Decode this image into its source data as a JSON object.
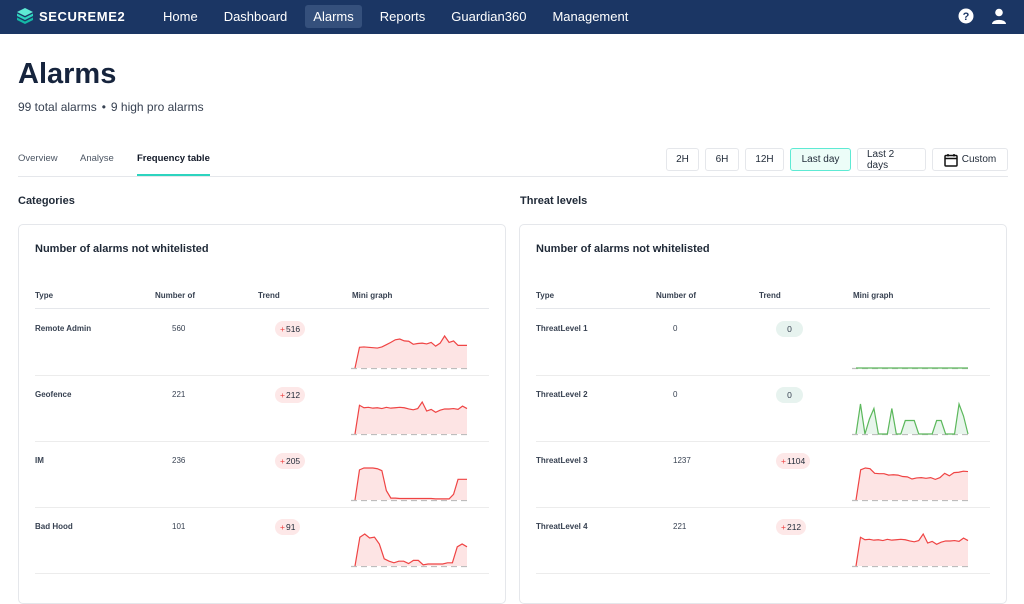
{
  "app": {
    "brand": "SECUREME2",
    "nav": [
      "Home",
      "Dashboard",
      "Alarms",
      "Reports",
      "Guardian360",
      "Management"
    ],
    "active_nav": "Alarms",
    "icons": [
      "help-icon",
      "user-icon"
    ]
  },
  "page": {
    "title": "Alarms",
    "total": "99 total alarms",
    "separator": "•",
    "high": "9 high pro alarms"
  },
  "tabs": [
    "Overview",
    "Analyse",
    "Frequency table"
  ],
  "active_tab": "Frequency table",
  "ranges": [
    "2H",
    "6H",
    "12H",
    "Last day",
    "Last 2 days",
    "Custom"
  ],
  "active_range": "Last day",
  "colors": {
    "nav_bg": "#1b3664",
    "accent": "#2dd4bf",
    "trend_up": "#ef4444",
    "trend_zero": "#5cb85c"
  },
  "sections": [
    {
      "title": "Categories",
      "card_title": "Number of alarms not whitelisted",
      "columns": [
        "Type",
        "Number of",
        "Trend",
        "Mini graph"
      ],
      "rows": [
        {
          "type": "Remote Admin",
          "count": "560",
          "trend": "516",
          "dir": "up",
          "series": [
            0,
            55,
            56,
            55,
            54,
            53,
            56,
            62,
            68,
            75,
            77,
            72,
            71,
            63,
            65,
            66,
            64,
            68,
            58,
            66,
            85,
            68,
            72,
            60,
            60,
            60
          ]
        },
        {
          "type": "Geofence",
          "count": "221",
          "trend": "212",
          "dir": "up",
          "series": [
            0,
            70,
            64,
            65,
            63,
            64,
            62,
            65,
            63,
            64,
            65,
            64,
            61,
            59,
            62,
            78,
            56,
            60,
            53,
            58,
            61,
            61,
            62,
            60,
            68,
            62
          ]
        },
        {
          "type": "IM",
          "count": "236",
          "trend": "205",
          "dir": "up",
          "series": [
            0,
            80,
            85,
            85,
            85,
            83,
            78,
            25,
            5,
            5,
            4,
            4,
            4,
            4,
            4,
            4,
            4,
            4,
            3,
            3,
            3,
            3,
            15,
            55,
            55,
            55
          ]
        },
        {
          "type": "Bad Hood",
          "count": "101",
          "trend": "91",
          "dir": "up",
          "series": [
            0,
            72,
            80,
            70,
            72,
            55,
            18,
            12,
            8,
            12,
            12,
            6,
            14,
            14,
            3,
            5,
            5,
            5,
            5,
            8,
            8,
            48,
            55,
            48
          ]
        }
      ]
    },
    {
      "title": "Threat levels",
      "card_title": "Number of alarms not whitelisted",
      "columns": [
        "Type",
        "Number of",
        "Trend",
        "Mini graph"
      ],
      "rows": [
        {
          "type": "ThreatLevel 1",
          "count": "0",
          "trend": "0",
          "dir": "zero",
          "series": [
            0,
            0,
            0,
            0,
            0,
            0,
            0,
            0,
            0,
            0,
            0,
            0,
            0,
            0,
            0,
            0,
            0,
            0,
            0,
            0
          ]
        },
        {
          "type": "ThreatLevel 2",
          "count": "0",
          "trend": "0",
          "dir": "zero",
          "series": [
            0,
            2,
            0,
            1,
            1.7,
            0,
            0,
            0,
            1.7,
            0,
            0,
            0.9,
            0.9,
            0.9,
            0,
            0,
            0,
            0,
            0.9,
            0.9,
            0,
            0,
            0,
            2,
            1.2,
            0
          ]
        },
        {
          "type": "ThreatLevel 3",
          "count": "1237",
          "trend": "1104",
          "dir": "up",
          "series": [
            0,
            85,
            90,
            88,
            75,
            74,
            74,
            70,
            71,
            70,
            66,
            65,
            59,
            62,
            63,
            61,
            63,
            58,
            63,
            75,
            68,
            77,
            78,
            81,
            80
          ]
        },
        {
          "type": "ThreatLevel 4",
          "count": "221",
          "trend": "212",
          "dir": "up",
          "series": [
            0,
            70,
            64,
            65,
            63,
            64,
            62,
            65,
            63,
            64,
            65,
            64,
            61,
            59,
            62,
            78,
            56,
            60,
            53,
            58,
            61,
            61,
            62,
            60,
            68,
            62
          ]
        }
      ]
    }
  ]
}
